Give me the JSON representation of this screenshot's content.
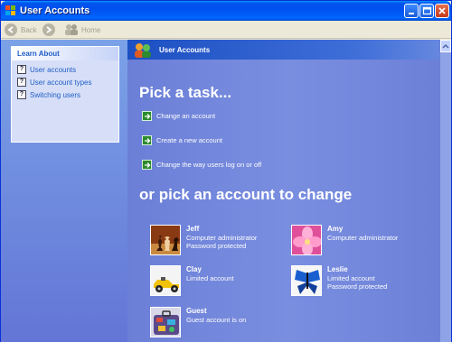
{
  "window": {
    "title": "User Accounts"
  },
  "toolbar": {
    "back_label": "Back",
    "home_label": "Home"
  },
  "learn": {
    "heading": "Learn About",
    "items": [
      {
        "label": "User accounts"
      },
      {
        "label": "User account types"
      },
      {
        "label": "Switching users"
      }
    ]
  },
  "main": {
    "header": "User Accounts",
    "pick_task": "Pick a task...",
    "tasks": [
      {
        "label": "Change an account"
      },
      {
        "label": "Create a new account"
      },
      {
        "label": "Change the way users log on or off"
      }
    ],
    "pick_account": "or pick an account to change",
    "accounts": [
      {
        "name": "Jeff",
        "line1": "Computer administrator",
        "line2": "Password protected",
        "picture": "chess-icon"
      },
      {
        "name": "Amy",
        "line1": "Computer administrator",
        "line2": "",
        "picture": "flower-icon"
      },
      {
        "name": "Clay",
        "line1": "Limited account",
        "line2": "",
        "picture": "car-icon"
      },
      {
        "name": "Leslie",
        "line1": "Limited account",
        "line2": "Password protected",
        "picture": "butterfly-icon"
      },
      {
        "name": "Guest",
        "line1": "Guest account is on",
        "line2": "",
        "picture": "suitcase-icon"
      }
    ]
  },
  "colors": {
    "title_blue": "#0053ee",
    "pane_blue": "#6b7fd7",
    "link_blue": "#215dc6",
    "task_green": "#2b8a2b"
  }
}
